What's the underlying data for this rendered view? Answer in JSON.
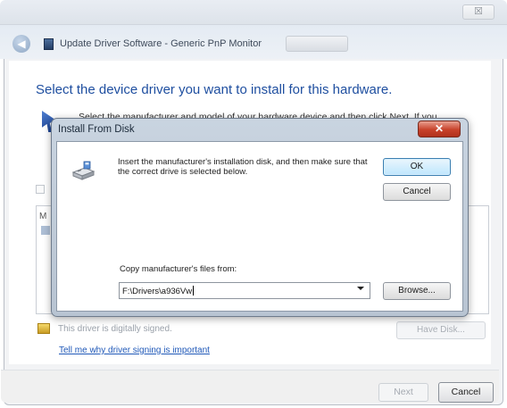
{
  "wizard": {
    "title": "Update Driver Software - Generic PnP Monitor",
    "close_glyph": "☒",
    "heading": "Select the device driver you want to install for this hardware.",
    "instruction": "Select the manufacturer and model of your hardware device and then click Next. If you",
    "list_label": "M",
    "driver_signed_text": "This driver is digitally signed.",
    "have_disk_label": "Have Disk...",
    "signing_link": "Tell me why driver signing is important",
    "next_label": "Next",
    "cancel_label": "Cancel"
  },
  "dialog": {
    "title": "Install From Disk",
    "close_glyph": "✕",
    "message": "Insert the manufacturer's installation disk, and then make sure that the correct drive is selected below.",
    "ok_label": "OK",
    "cancel_label": "Cancel",
    "copy_label": "Copy manufacturer's files from:",
    "path_value": "F:\\Drivers\\a936Vw",
    "browse_label": "Browse..."
  },
  "colors": {
    "heading_blue": "#1f4fa0",
    "close_red": "#c7412a",
    "ok_border": "#3c7fb1"
  },
  "icons": [
    "back-arrow-icon",
    "monitor-icon",
    "cursor-arrow-icon",
    "disk-drive-icon",
    "warning-shield-icon",
    "dropdown-arrow-icon",
    "close-icon"
  ]
}
